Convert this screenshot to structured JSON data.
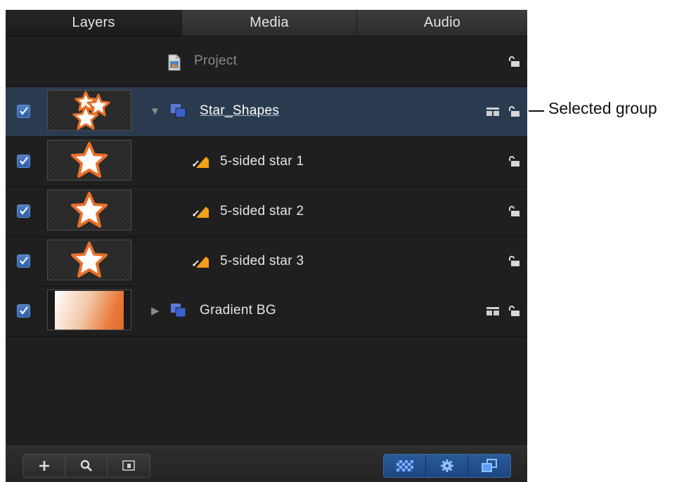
{
  "tabs": [
    {
      "label": "Layers",
      "active": true
    },
    {
      "label": "Media",
      "active": false
    },
    {
      "label": "Audio",
      "active": false
    }
  ],
  "project": {
    "label": "Project"
  },
  "layers": [
    {
      "label": "Star_Shapes",
      "kind": "group",
      "checked": true,
      "selected": true,
      "expanded": true,
      "icon": "group-icon",
      "thumbnail": "stars-thumbnail"
    },
    {
      "label": "5-sided star 1",
      "kind": "shape",
      "checked": true,
      "selected": false,
      "icon": "shape-icon",
      "thumbnail": "star-thumbnail"
    },
    {
      "label": "5-sided star 2",
      "kind": "shape",
      "checked": true,
      "selected": false,
      "icon": "shape-icon",
      "thumbnail": "star-thumbnail"
    },
    {
      "label": "5-sided star 3",
      "kind": "shape",
      "checked": true,
      "selected": false,
      "icon": "shape-icon",
      "thumbnail": "star-thumbnail"
    },
    {
      "label": "Gradient BG",
      "kind": "group",
      "checked": true,
      "selected": false,
      "expanded": false,
      "icon": "group-icon",
      "thumbnail": "gradient-thumbnail"
    }
  ],
  "toolbar": {
    "left_buttons": [
      "add-icon",
      "search-icon",
      "presentation-icon"
    ],
    "right_buttons": [
      "checkerboard-icon",
      "gear-icon",
      "layers-icon"
    ]
  },
  "callout": {
    "label": "Selected group"
  },
  "colors": {
    "accent": "#2b3b4f",
    "star_orange": "#e8702a",
    "checkbox_blue": "#3f70bd"
  }
}
